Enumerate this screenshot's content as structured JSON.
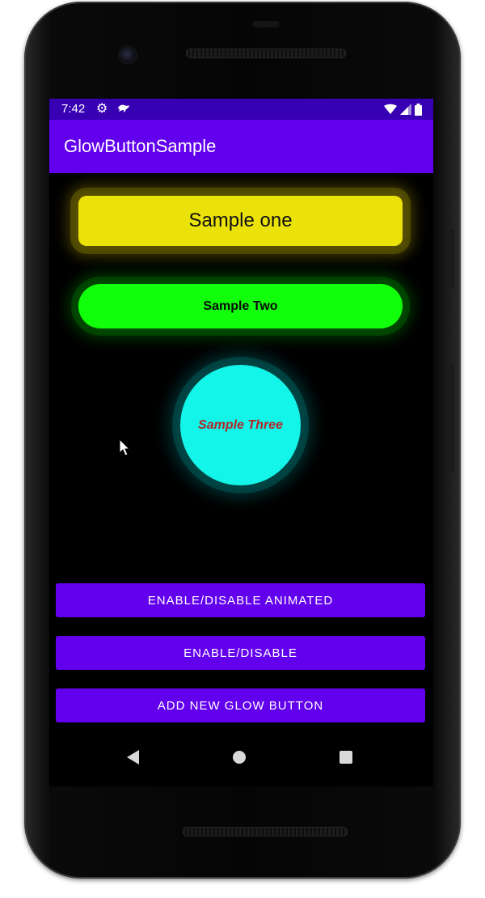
{
  "status_bar": {
    "time": "7:42",
    "icons": [
      "settings-gear-icon",
      "lizard-notification-icon",
      "wifi-icon",
      "cell-signal-icon",
      "battery-icon"
    ]
  },
  "app_bar": {
    "title": "GlowButtonSample"
  },
  "glow_buttons": {
    "one": {
      "label": "Sample one",
      "color": "#ebe20a"
    },
    "two": {
      "label": "Sample Two",
      "color": "#11ff0a"
    },
    "three": {
      "label": "Sample Three",
      "color": "#12f5e8",
      "text_color": "#b3262b"
    }
  },
  "actions": {
    "animated": "ENABLE/DISABLE ANIMATED",
    "toggle": "ENABLE/DISABLE",
    "add": "ADD NEW GLOW BUTTON"
  },
  "nav_bar": {
    "icons": [
      "back-icon",
      "home-icon",
      "recents-icon"
    ]
  },
  "colors": {
    "primary": "#6200ee",
    "primary_dark": "#3700b3",
    "background": "#000000"
  }
}
